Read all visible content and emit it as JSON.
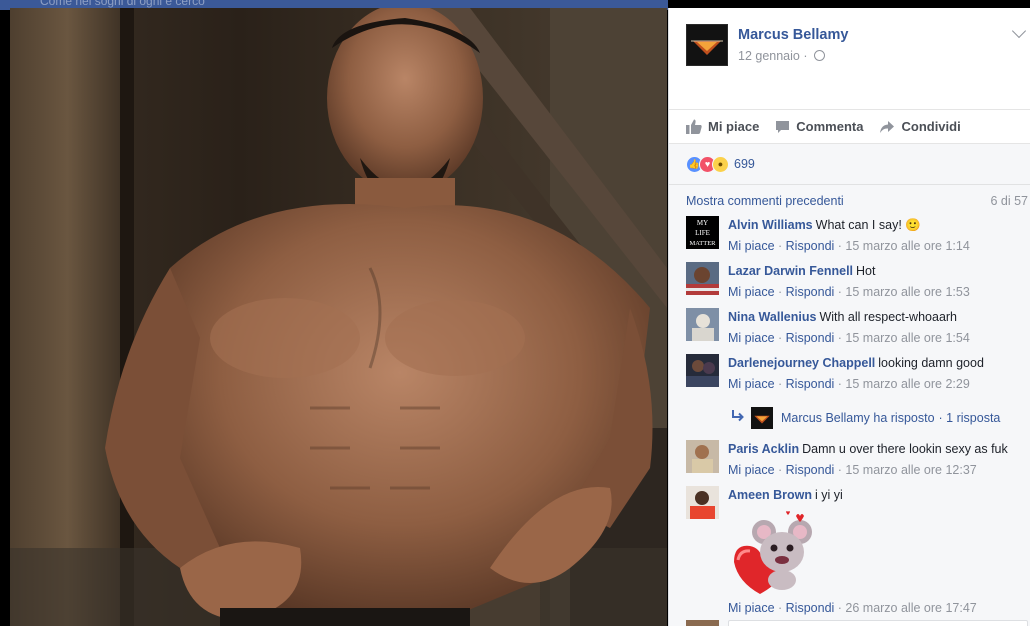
{
  "background_tab": {
    "ghost_text": "Come nei sogni di ogni e cerco"
  },
  "post": {
    "page_name": "Marcus Bellamy",
    "date": "12 gennaio",
    "privacy_icon": "globe-icon"
  },
  "actions": {
    "like_label": "Mi piace",
    "comment_label": "Commenta",
    "share_label": "Condividi"
  },
  "reactions": {
    "count": "699",
    "types": [
      "like",
      "love",
      "wow"
    ]
  },
  "comments_header": {
    "more_label": "Mostra commenti precedenti",
    "count_label": "6 di 57"
  },
  "comment_meta": {
    "like": "Mi piace",
    "reply": "Rispondi",
    "sep": " · "
  },
  "comments": [
    {
      "author": "Alvin Williams",
      "text": "What can I say! 🙂",
      "time": "15 marzo alle ore 1:14"
    },
    {
      "author": "Lazar Darwin Fennell",
      "text": "Hot",
      "time": "15 marzo alle ore 1:53"
    },
    {
      "author": "Nina Wallenius",
      "text": "With all respect-whoaarh",
      "time": "15 marzo alle ore 1:54"
    },
    {
      "author": "Darlenejourney Chappell",
      "text": "looking damn good",
      "time": "15 marzo alle ore 2:29"
    },
    {
      "author": "Paris Acklin",
      "text": "Damn u over there lookin sexy as fuk",
      "time": "15 marzo alle ore 12:37"
    },
    {
      "author": "Ameen Brown",
      "text": "i yi yi",
      "time": "26 marzo alle ore 17:47"
    }
  ],
  "reply": {
    "text": "Marcus Bellamy ha risposto",
    "count": "1 risposta"
  },
  "avatar_text": {
    "alvin": [
      "MY",
      "LIFE",
      "MATTER"
    ]
  }
}
